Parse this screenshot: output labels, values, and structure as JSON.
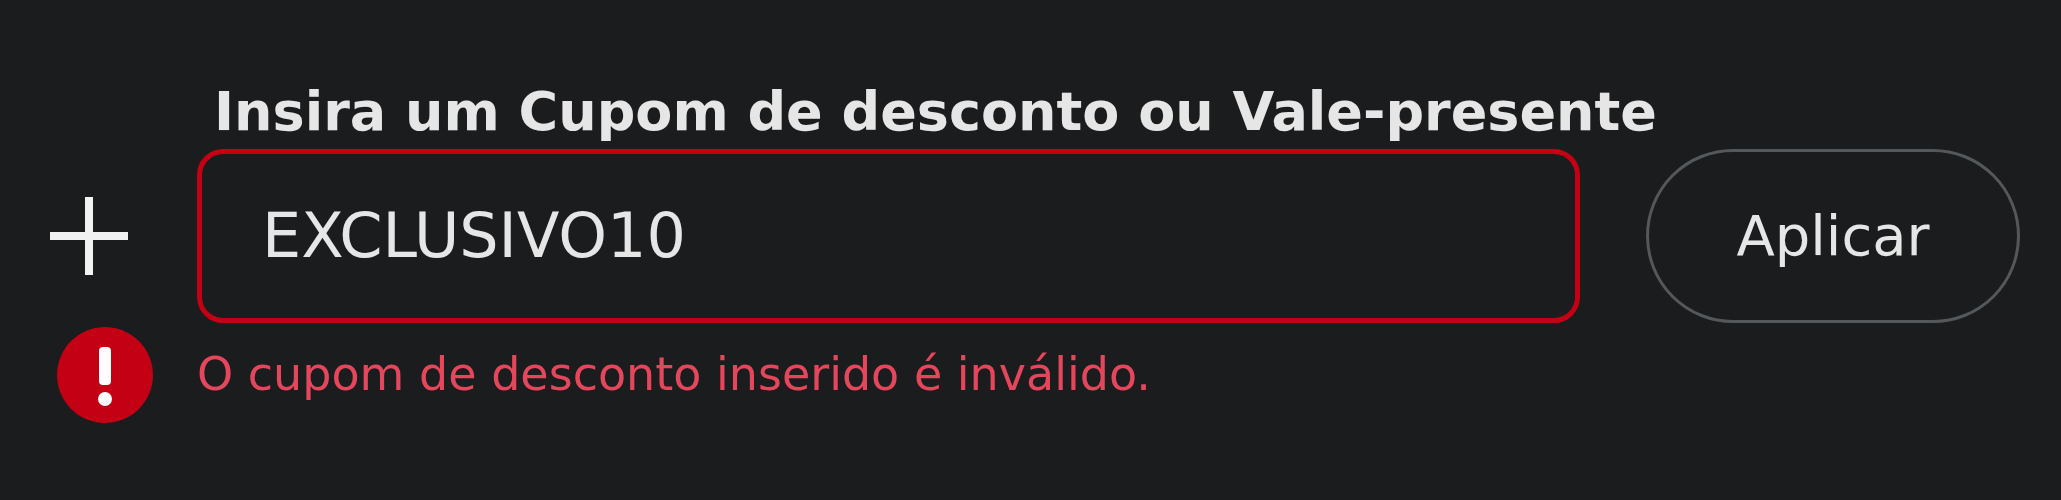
{
  "coupon": {
    "label": "Insira um Cupom de desconto ou Vale-presente",
    "value": "EXCLUSIVO10",
    "invalid": true,
    "error": "O cupom de desconto inserido é inválido.",
    "apply_button": "Aplicar"
  }
}
